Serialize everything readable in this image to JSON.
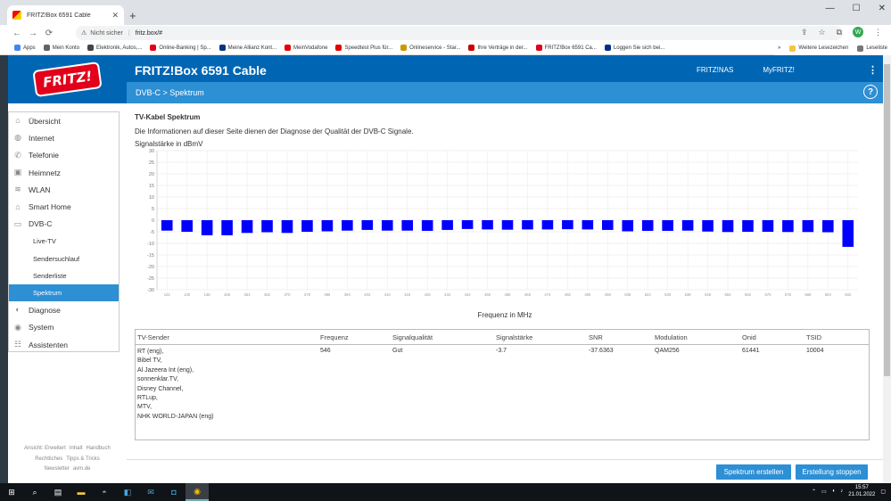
{
  "browser": {
    "tab_title": "FRITZ!Box 6591 Cable",
    "tab_close": "✕",
    "new_tab": "+",
    "security": "Nicht sicher",
    "url": "fritz.box/#",
    "profile_initial": "W",
    "window_controls": [
      "—",
      "☐",
      "✕"
    ],
    "nav_back": "←",
    "nav_forward": "→",
    "nav_reload": "⟳"
  },
  "bookmarks": {
    "items": [
      {
        "label": "Apps",
        "color": "#4285f4"
      },
      {
        "label": "Mein Konto",
        "color": "#5f6368"
      },
      {
        "label": "Elektronik, Autos,...",
        "color": "#444"
      },
      {
        "label": "Online-Banking | Sp...",
        "color": "#e2001a"
      },
      {
        "label": "Meine Allianz Kont...",
        "color": "#003781"
      },
      {
        "label": "MeinVodafone",
        "color": "#e60000"
      },
      {
        "label": "Speedtest Plus für...",
        "color": "#e60000"
      },
      {
        "label": "Onlineservice - Star...",
        "color": "#c90"
      },
      {
        "label": "Ihre Verträge in der...",
        "color": "#c00"
      },
      {
        "label": "FRITZ!Box 6591 Ca...",
        "color": "#e2001a"
      },
      {
        "label": "Loggen Sie sich bei...",
        "color": "#003087"
      }
    ],
    "more": "»",
    "other": "Weitere Lesezeichen",
    "reading_list": "Leseliste"
  },
  "header": {
    "logo": "FRITZ!",
    "product": "FRITZ!Box 6591 Cable",
    "links": [
      "FRITZ!NAS",
      "MyFRITZ!"
    ],
    "menu": "⋮",
    "breadcrumb": "DVB-C  >  Spektrum",
    "help": "?"
  },
  "sidebar": {
    "items": [
      {
        "label": "Übersicht",
        "icon": "⌂"
      },
      {
        "label": "Internet",
        "icon": "◍"
      },
      {
        "label": "Telefonie",
        "icon": "✆"
      },
      {
        "label": "Heimnetz",
        "icon": "▣"
      },
      {
        "label": "WLAN",
        "icon": "≋"
      },
      {
        "label": "Smart Home",
        "icon": "⌂"
      },
      {
        "label": "DVB-C",
        "icon": "▭"
      }
    ],
    "sub": [
      "Live-TV",
      "Sendersuchlauf",
      "Senderliste",
      "Spektrum"
    ],
    "items2": [
      {
        "label": "Diagnose",
        "icon": "◐"
      },
      {
        "label": "System",
        "icon": "◉"
      },
      {
        "label": "Assistenten",
        "icon": "☷"
      }
    ],
    "footer": [
      "Ansicht: Erweitert",
      "Inhalt",
      "Handbuch",
      "Rechtliches",
      "Tipps & Tricks",
      "Newsletter",
      "avm.de"
    ]
  },
  "content": {
    "title": "TV-Kabel Spektrum",
    "description": "Die Informationen auf dieser Seite dienen der Diagnose der Qualität der DVB-C Signale.",
    "y_unit": "Signalstärke in dBmV",
    "x_title": "Frequenz in MHz"
  },
  "chart_data": {
    "type": "bar",
    "ylabel": "Signalstärke in dBmV",
    "xlabel": "Frequenz in MHz",
    "ylim": [
      -30,
      30
    ],
    "yticks": [
      30,
      25,
      20,
      15,
      10,
      5,
      0,
      -5,
      -10,
      -15,
      -20,
      -25,
      -30
    ],
    "grid": true,
    "bar_color": "#0000ff",
    "categories": [
      "122",
      "130",
      "138",
      "346",
      "354",
      "362",
      "370",
      "378",
      "386",
      "394",
      "402",
      "410",
      "418",
      "426",
      "434",
      "442",
      "450",
      "458",
      "466",
      "474",
      "482",
      "490",
      "498",
      "506",
      "522",
      "530",
      "538",
      "546",
      "554",
      "562",
      "570",
      "578",
      "586",
      "594",
      "602"
    ],
    "values": [
      -4.5,
      -5,
      -6.5,
      -6.5,
      -5.5,
      -5.2,
      -5.5,
      -5,
      -4.8,
      -4.5,
      -4.2,
      -4.5,
      -4.5,
      -4.6,
      -4.2,
      -3.8,
      -4,
      -4.1,
      -4,
      -4,
      -3.9,
      -4,
      -4.2,
      -4.8,
      -4.6,
      -4.6,
      -4.5,
      -4.9,
      -5.1,
      -5,
      -5,
      -5.1,
      -5.1,
      -5.2,
      -11.5
    ]
  },
  "table": {
    "headers": [
      "TV-Sender",
      "Frequenz",
      "Signalqualität",
      "Signalstärke",
      "SNR",
      "Modulation",
      "Onid",
      "TSID"
    ],
    "row": {
      "sender": [
        "RT (eng),",
        "Bibel TV,",
        "Al Jazeera Int (eng),",
        "sonnenklar.TV,",
        "Disney Channel,",
        "RTLup,",
        "MTV,",
        "NHK WORLD-JAPAN (eng)"
      ],
      "frequenz": "546",
      "qualitaet": "Gut",
      "staerke": "-3.7",
      "snr": "-37.6363",
      "modulation": "QAM256",
      "onid": "61441",
      "tsid": "10004"
    }
  },
  "buttons": {
    "create": "Spektrum erstellen",
    "stop": "Erstellung stoppen"
  },
  "taskbar": {
    "time": "15:57",
    "date": "21.01.2022",
    "tray_icons": [
      "⌃",
      "▭",
      "◖",
      "♪"
    ]
  }
}
